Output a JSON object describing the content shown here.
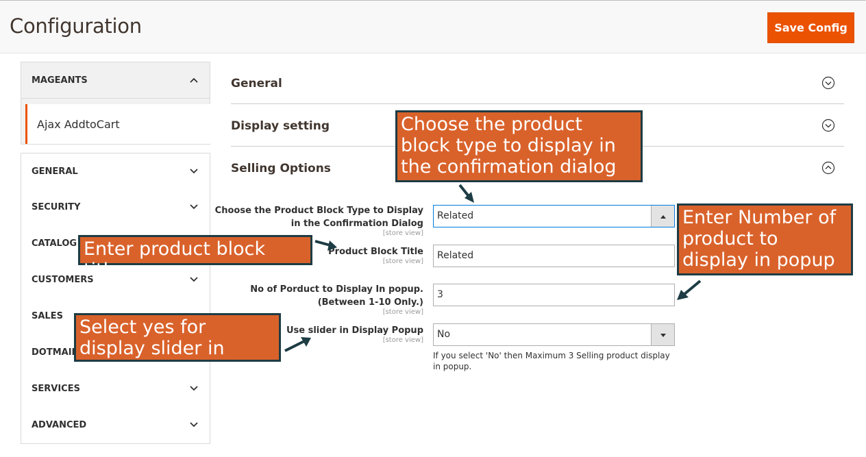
{
  "header": {
    "title": "Configuration",
    "save_label": "Save Config"
  },
  "sidebar": {
    "group_label": "MAGEANTS",
    "sub_item": "Ajax AddtoCart",
    "items": [
      {
        "label": "GENERAL"
      },
      {
        "label": "SECURITY"
      },
      {
        "label": "CATALOG"
      },
      {
        "label": "CUSTOMERS"
      },
      {
        "label": "SALES"
      },
      {
        "label": "DOTMAILER"
      },
      {
        "label": "SERVICES"
      },
      {
        "label": "ADVANCED"
      }
    ]
  },
  "sections": [
    {
      "title": "General"
    },
    {
      "title": "Display setting"
    },
    {
      "title": "Selling Options"
    }
  ],
  "fields": {
    "block_type": {
      "label_line1": "Choose the Product Block Type to Display",
      "label_line2": "in the Confirmation Dialog",
      "scope": "[store view]",
      "value": "Related"
    },
    "block_title": {
      "label": "Product Block Title",
      "scope": "[store view]",
      "value": "Related"
    },
    "product_count": {
      "label_line1": "No of Porduct to Display In popup.",
      "label_line2": "(Between 1-10 Only.)",
      "scope": "[store view]",
      "value": "3"
    },
    "slider": {
      "label": "Use slider in Display Popup",
      "scope": "[store view]",
      "value": "No",
      "note": "If you select 'No' then Maximum 3 Selling product display in popup."
    }
  },
  "callouts": {
    "block_type": "Choose the product block type to display in the confirmation dialog",
    "block_title": "Enter product block title",
    "product_count": "Enter Number of product to display in popup",
    "slider": "Select yes for display slider in popup"
  },
  "colors": {
    "accent": "#eb5202",
    "callout_bg": "#d9622b",
    "callout_border": "#1d3c44"
  },
  "icons": {
    "collapse": "chevron-up-icon",
    "expand": "chevron-down-icon",
    "section_toggle": "circle-chevron-icon"
  }
}
